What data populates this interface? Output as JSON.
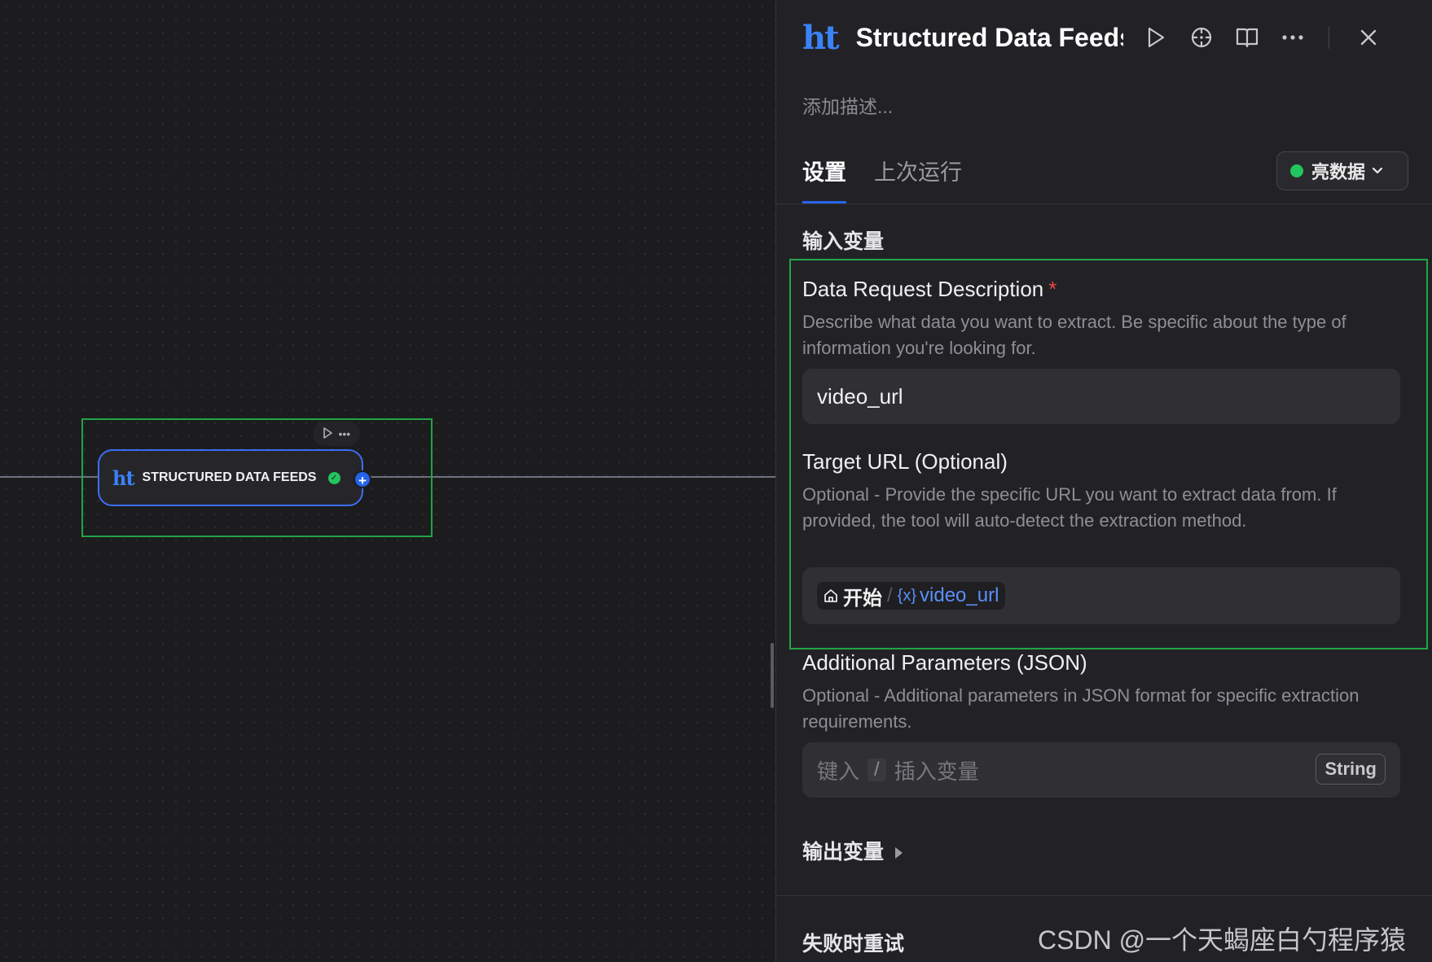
{
  "canvas": {
    "node": {
      "logo": "ht",
      "title": "STRUCTURED DATA FEEDS"
    }
  },
  "panel": {
    "logo": "ht",
    "title": "Structured Data Feeds",
    "description_placeholder": "添加描述...",
    "tabs": [
      {
        "label": "设置",
        "active": true
      },
      {
        "label": "上次运行",
        "active": false
      }
    ],
    "provider": {
      "label": "亮数据",
      "status_color": "#22c55e"
    },
    "input_section_title": "输入变量",
    "fields": [
      {
        "label": "Data Request Description",
        "required": "*",
        "help": "Describe what data you want to extract. Be specific about the type of information you're looking for.",
        "value": "video_url"
      },
      {
        "label": "Target URL (Optional)",
        "help": "Optional - Provide the specific URL you want to extract data from. If provided, the tool will auto-detect the extraction method.",
        "chip": {
          "node": "开始",
          "separator": "/",
          "var_icon": "{x}",
          "variable": "video_url"
        }
      },
      {
        "label": "Additional Parameters (JSON)",
        "help": "Optional - Additional parameters in JSON format for specific extraction requirements.",
        "placeholder_prefix": "键入",
        "placeholder_slash": "/",
        "placeholder_suffix": "插入变量",
        "type": "String"
      }
    ],
    "output_section_title": "输出变量",
    "retry_section_title": "失败时重试"
  },
  "watermark": "CSDN @一个天蝎座白勺程序猿",
  "colors": {
    "accent": "#2563eb",
    "brand_logo": "#3b82f6",
    "success": "#22c55e",
    "selection": "#22a447"
  }
}
